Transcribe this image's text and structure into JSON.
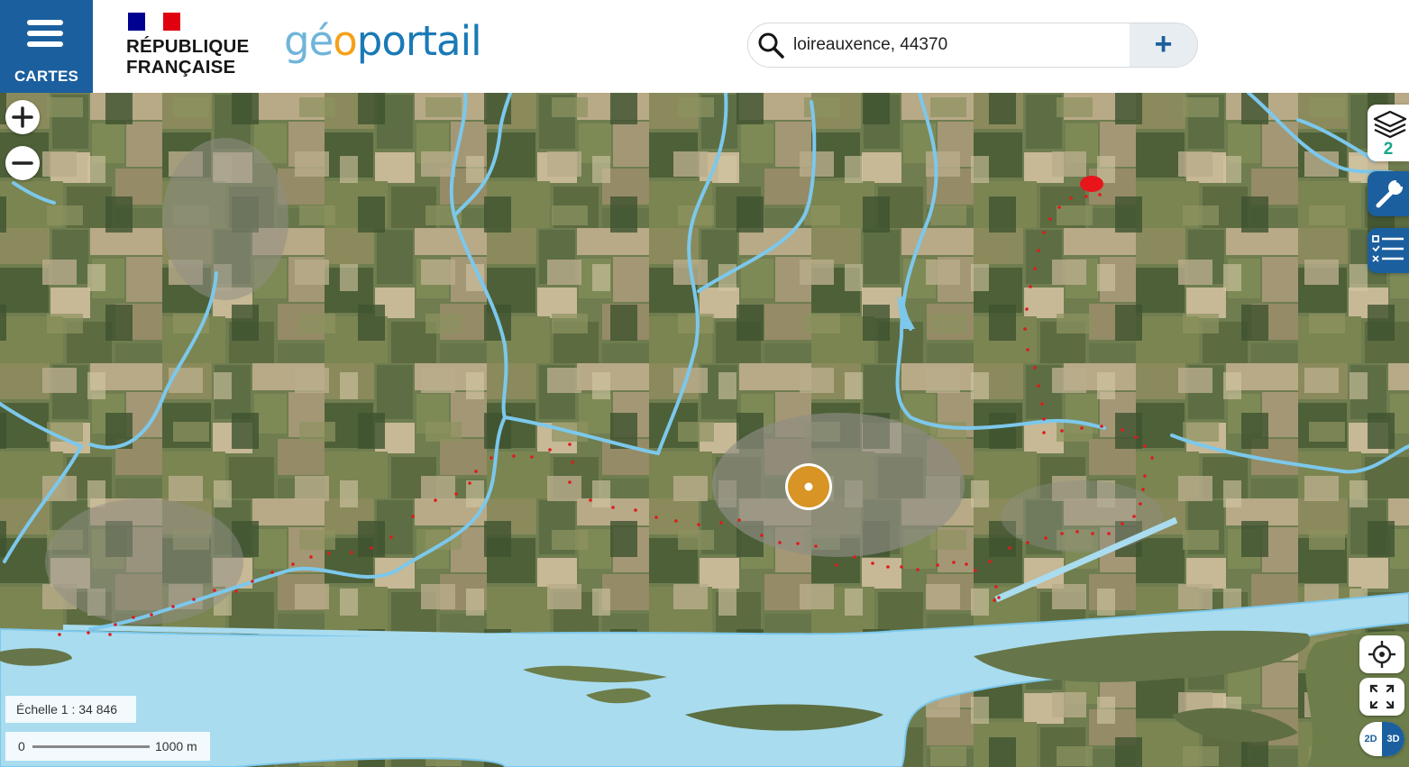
{
  "header": {
    "menu_label": "CARTES",
    "rf_line1": "RÉPUBLIQUE",
    "rf_line2": "FRANÇAISE",
    "logo_part1": "gé",
    "logo_part2": "o",
    "logo_part3": "portail",
    "search_value": "loireauxence, 44370",
    "search_add": "+"
  },
  "layers": {
    "count": "2"
  },
  "scale": {
    "label": "Échelle 1 :  34 846",
    "bar_start": "0",
    "bar_end": "1000 m"
  },
  "view_toggle": {
    "mode_2d": "2D",
    "mode_3d": "3D"
  },
  "colors": {
    "brand_blue": "#1b5f9e",
    "water": "#a9dcef",
    "river_line": "#7cc8ec",
    "route_dots": "#e01a1a",
    "marker": "#d89425"
  }
}
